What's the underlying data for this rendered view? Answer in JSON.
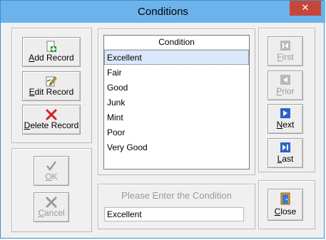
{
  "window": {
    "title": "Conditions",
    "close_glyph": "✕"
  },
  "record_buttons": {
    "add": {
      "label": "Add Record",
      "hotkey": "A",
      "rest": "dd Record",
      "icon": "add-record-icon"
    },
    "edit": {
      "label": "Edit Record",
      "hotkey": "E",
      "rest": "dit Record",
      "icon": "edit-record-icon"
    },
    "delete": {
      "label": "Delete Record",
      "hotkey": "D",
      "rest": "elete Record",
      "icon": "delete-record-icon"
    }
  },
  "confirm_buttons": {
    "ok": {
      "label": "OK",
      "hotkey": "O",
      "rest": "K",
      "enabled": false
    },
    "cancel": {
      "label": "Cancel",
      "hotkey": "C",
      "rest": "ancel",
      "enabled": false
    }
  },
  "list": {
    "header": "Condition",
    "items": [
      "Excellent",
      "Fair",
      "Good",
      "Junk",
      "Mint",
      "Poor",
      "Very Good"
    ],
    "selected_index": 0
  },
  "entry": {
    "prompt": "Please Enter the Condition",
    "value": "Excellent"
  },
  "nav_buttons": {
    "first": {
      "label": "First",
      "hotkey": "F",
      "rest": "irst",
      "enabled": false
    },
    "prior": {
      "label": "Prior",
      "hotkey": "P",
      "rest": "rior",
      "enabled": false
    },
    "next": {
      "label": "Next",
      "hotkey": "N",
      "rest": "ext",
      "enabled": true
    },
    "last": {
      "label": "Last",
      "hotkey": "L",
      "rest": "ast",
      "enabled": true
    },
    "close": {
      "label": "Close",
      "hotkey": "C",
      "rest": "lose",
      "enabled": true
    }
  },
  "colors": {
    "titlebar": "#6cb3ec",
    "close": "#c7463b",
    "selection": "#dbe8fb",
    "nav_blue": "#2b62c9",
    "disabled": "#9a9a9a"
  }
}
